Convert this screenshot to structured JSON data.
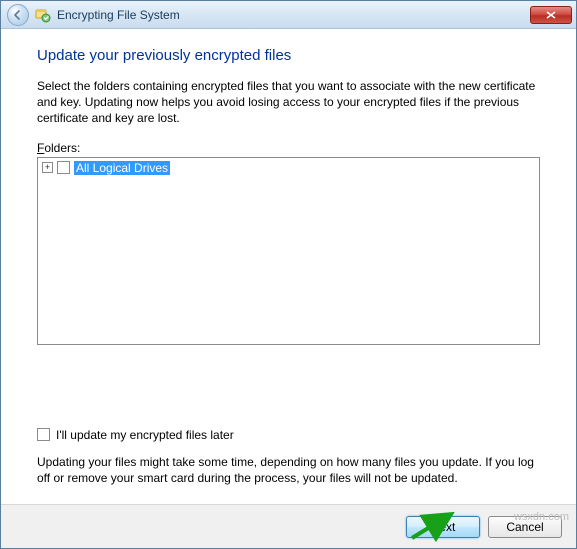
{
  "titlebar": {
    "title": "Encrypting File System"
  },
  "content": {
    "heading": "Update your previously encrypted files",
    "description": "Select the folders containing encrypted files that you want to associate with the new certificate and key. Updating now helps you avoid losing access to your encrypted files if the previous certificate and key are lost.",
    "folders_label_prefix": "F",
    "folders_label_rest": "olders:",
    "tree_root": "All Logical Drives",
    "update_later_label": "I'll update my encrypted files later",
    "note": "Updating your files might take some time, depending on how many files you update. If you log off or remove your smart card during the process, your files will not be updated."
  },
  "footer": {
    "next_label": "Next",
    "cancel_label": "Cancel"
  },
  "watermark": "wsxdn.com"
}
